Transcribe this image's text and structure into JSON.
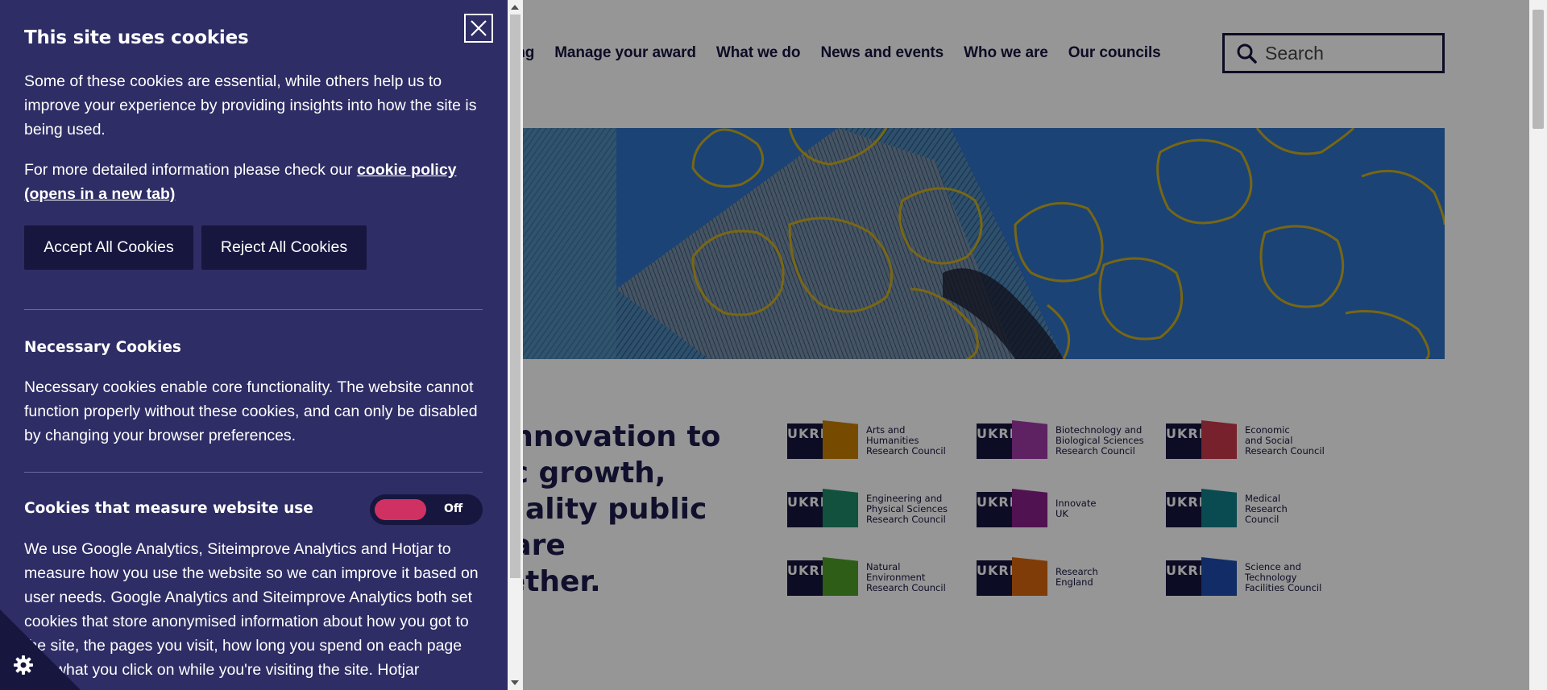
{
  "nav": {
    "items": [
      {
        "label": "nding"
      },
      {
        "label": "Manage your award"
      },
      {
        "label": "What we do"
      },
      {
        "label": "News and events"
      },
      {
        "label": "Who we are"
      },
      {
        "label": "Our councils"
      }
    ]
  },
  "search": {
    "placeholder": "Search"
  },
  "mission": {
    "lines": [
      "nd innovation to",
      "omic growth,",
      "h-quality public",
      " We are",
      "together."
    ]
  },
  "councils": [
    {
      "name": "Arts and Humanities Research Council",
      "lines": [
        "Arts and",
        "Humanities",
        "Research Council"
      ],
      "color": "#c98000"
    },
    {
      "name": "Biotechnology and Biological Sciences Research Council",
      "lines": [
        "Biotechnology and",
        "Biological Sciences",
        "Research Council"
      ],
      "color": "#a13ba8"
    },
    {
      "name": "Economic and Social Research Council",
      "lines": [
        "Economic",
        "and Social",
        "Research Council"
      ],
      "color": "#c9384a"
    },
    {
      "name": "Engineering and Physical Sciences Research Council",
      "lines": [
        "Engineering and",
        "Physical Sciences",
        "Research Council"
      ],
      "color": "#1f8a6a"
    },
    {
      "name": "Innovate UK",
      "lines": [
        "Innovate",
        "UK"
      ],
      "color": "#8a1f8a"
    },
    {
      "name": "Medical Research Council",
      "lines": [
        "Medical",
        "Research",
        "Council"
      ],
      "color": "#127f8a"
    },
    {
      "name": "Natural Environment Research Council",
      "lines": [
        "Natural",
        "Environment",
        "Research Council"
      ],
      "color": "#4f9e2a"
    },
    {
      "name": "Research England",
      "lines": [
        "Research",
        "England"
      ],
      "color": "#d9660f"
    },
    {
      "name": "Science and Technology Facilities Council",
      "lines": [
        "Science and",
        "Technology",
        "Facilities Council"
      ],
      "color": "#1f4bb0"
    }
  ],
  "ukri_label": "UKRI",
  "cookie": {
    "title": "This site uses cookies",
    "intro": "Some of these cookies are essential, while others help us to improve your experience by providing insights into how the site is being used.",
    "more_prefix": "For more detailed information please check our ",
    "policy_link": "cookie policy (opens in a new tab)",
    "accept_label": "Accept All Cookies",
    "reject_label": "Reject All Cookies",
    "necessary_title": "Necessary Cookies",
    "necessary_text": "Necessary cookies enable core functionality. The website cannot function properly without these cookies, and can only be disabled by changing your browser preferences.",
    "measure_title": "Cookies that measure website use",
    "measure_toggle_state": "Off",
    "measure_text": "We use Google Analytics, Siteimprove Analytics and Hotjar to measure how you use the website so we can improve it based on user needs. Google Analytics and Siteimprove Analytics both set cookies that store anonymised information about how you got to the site, the pages you visit, how long you spend on each page and what you click on while you're visiting the site. Hotjar"
  },
  "colors": {
    "panel_bg": "#2e2d65",
    "button_bg": "#16163f",
    "toggle_knob": "#cf3262",
    "hero_blue": "#2f73c8",
    "hero_gold": "#d4b21a"
  },
  "icons": {
    "close": "close-icon",
    "search": "search-icon",
    "cookie_settings": "cog-icon"
  }
}
